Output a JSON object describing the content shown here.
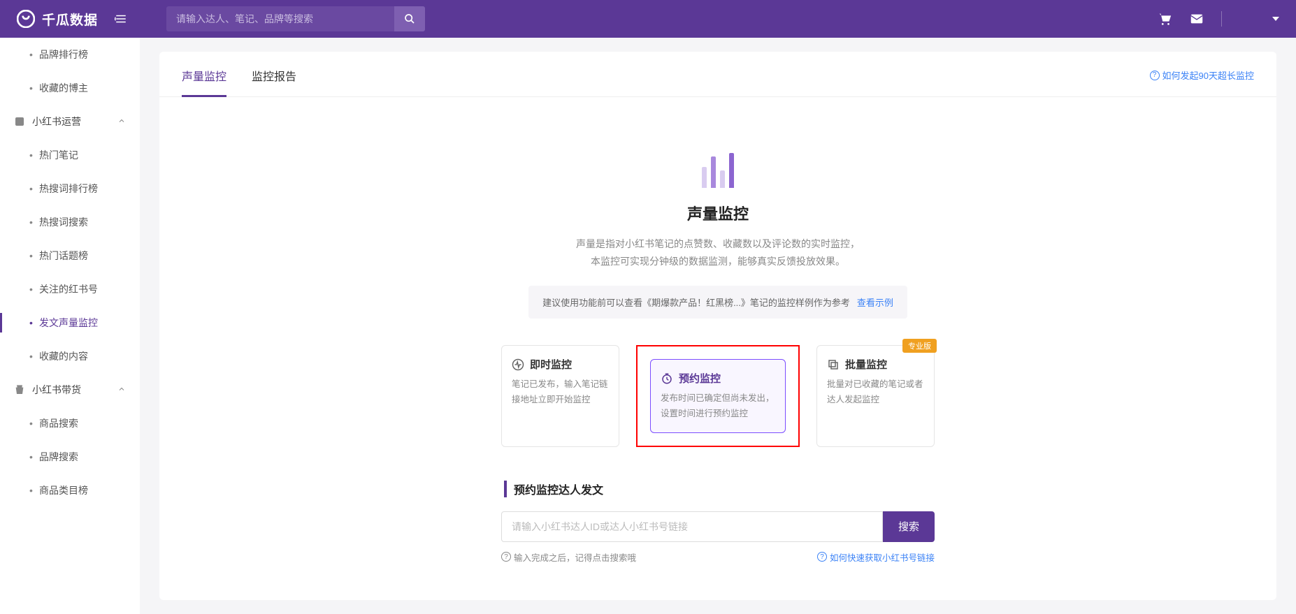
{
  "brand": "千瓜数据",
  "search_placeholder": "请输入达人、笔记、品牌等搜索",
  "sidebar": {
    "items_top": [
      "品牌排行榜",
      "收藏的博主"
    ],
    "group1": {
      "label": "小红书运营",
      "items": [
        "热门笔记",
        "热搜词排行榜",
        "热搜词搜索",
        "热门话题榜",
        "关注的红书号",
        "发文声量监控",
        "收藏的内容"
      ],
      "active": "发文声量监控"
    },
    "group2": {
      "label": "小红书带货",
      "items": [
        "商品搜索",
        "品牌搜索",
        "商品类目榜"
      ]
    }
  },
  "tabs": {
    "items": [
      "声量监控",
      "监控报告"
    ],
    "active": "声量监控",
    "right_link": "如何发起90天超长监控"
  },
  "hero": {
    "title": "声量监控",
    "desc1": "声量是指对小红书笔记的点赞数、收藏数以及评论数的实时监控，",
    "desc2": "本监控可实现分钟级的数据监测，能够真实反馈投放效果。",
    "hint": "建议使用功能前可以查看《期爆款产品！红黑榜...》笔记的监控样例作为参考",
    "hint_link": "查看示例"
  },
  "options": [
    {
      "title": "即时监控",
      "desc": "笔记已发布，输入笔记链接地址立即开始监控"
    },
    {
      "title": "预约监控",
      "desc": "发布时间已确定但尚未发出，设置时间进行预约监控"
    },
    {
      "title": "批量监控",
      "desc": "批量对已收藏的笔记或者达人发起监控",
      "badge": "专业版"
    }
  ],
  "section": {
    "title": "预约监控达人发文",
    "input_placeholder": "请输入小红书达人ID或达人小红书号链接",
    "search_btn": "搜索",
    "tip_left": "输入完成之后，记得点击搜索哦",
    "tip_right": "如何快速获取小红书号链接"
  }
}
